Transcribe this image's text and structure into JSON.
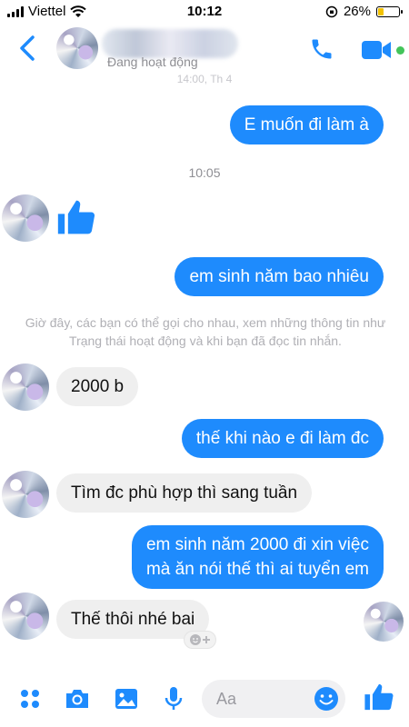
{
  "status_bar": {
    "carrier": "Viettel",
    "time": "10:12",
    "battery": "26%",
    "battery_level": 0.26
  },
  "header": {
    "status": "Đang hoạt động",
    "old_timestamp": "14:00, Th 4"
  },
  "colors": {
    "accent": "#1e8bfd",
    "incoming_bubble": "#efefef",
    "online": "#43c45a"
  },
  "messages": {
    "m1": "E muốn đi làm à",
    "time1": "10:05",
    "m2": "em sinh năm bao nhiêu",
    "notice": "Giờ đây, các bạn có thể gọi cho nhau, xem những thông tin như Trạng thái hoạt động và khi bạn đã đọc tin nhắn.",
    "m3": "2000 b",
    "m4": "thế khi nào e đi làm đc",
    "m5": "Tìm đc phù hợp thì sang tuần",
    "m6_line1": "em sinh năm 2000 đi xin việc",
    "m6_line2": "mà ăn nói thế thì ai tuyển em",
    "m7": "Thế thôi nhé bai"
  },
  "composer": {
    "placeholder": "Aa"
  },
  "icons": [
    "back-icon",
    "phone-icon",
    "video-camera-icon",
    "like-icon",
    "apps-icon",
    "camera-icon",
    "gallery-icon",
    "microphone-icon",
    "emoji-icon",
    "add-reaction-icon"
  ]
}
